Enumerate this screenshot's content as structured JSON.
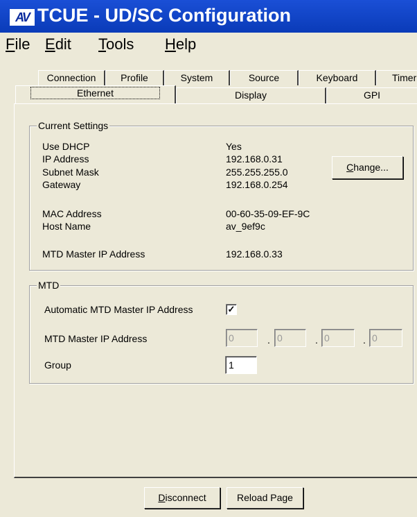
{
  "window": {
    "icon_text": "AV",
    "title": "TCUE - UD/SC Configuration"
  },
  "menu": [
    {
      "mnemonic": "F",
      "rest": "ile"
    },
    {
      "mnemonic": "E",
      "rest": "dit"
    },
    {
      "mnemonic": "T",
      "rest": "ools"
    },
    {
      "mnemonic": "H",
      "rest": "elp"
    }
  ],
  "tabs_back": [
    "Connection",
    "Profile",
    "System",
    "Source",
    "Keyboard",
    "Timer"
  ],
  "tabs_front": [
    "Ethernet",
    "Display",
    "GPI"
  ],
  "active_tab": "Ethernet",
  "current_settings": {
    "legend": "Current Settings",
    "rows": [
      {
        "label": "Use DHCP",
        "value": "Yes"
      },
      {
        "label": "IP Address",
        "value": "192.168.0.31"
      },
      {
        "label": "Subnet Mask",
        "value": "255.255.255.0"
      },
      {
        "label": "Gateway",
        "value": "192.168.0.254"
      },
      {
        "label": "MAC Address",
        "value": "00-60-35-09-EF-9C"
      },
      {
        "label": "Host Name",
        "value": "av_9ef9c"
      },
      {
        "label": "MTD Master IP Address",
        "value": "192.168.0.33"
      }
    ],
    "change_button": {
      "mnemonic": "C",
      "rest": "hange..."
    }
  },
  "mtd": {
    "legend": "MTD",
    "auto_label": "Automatic MTD Master IP Address",
    "auto_checked": true,
    "check_mark": "✓",
    "ip_label": "MTD Master IP Address",
    "ip_octets": [
      "0",
      "0",
      "0",
      "0"
    ],
    "ip_separator": ".",
    "group_label": "Group",
    "group_value": "1"
  },
  "footer": {
    "disconnect": {
      "mnemonic": "D",
      "rest": "isconnect"
    },
    "reload": "Reload Page"
  }
}
